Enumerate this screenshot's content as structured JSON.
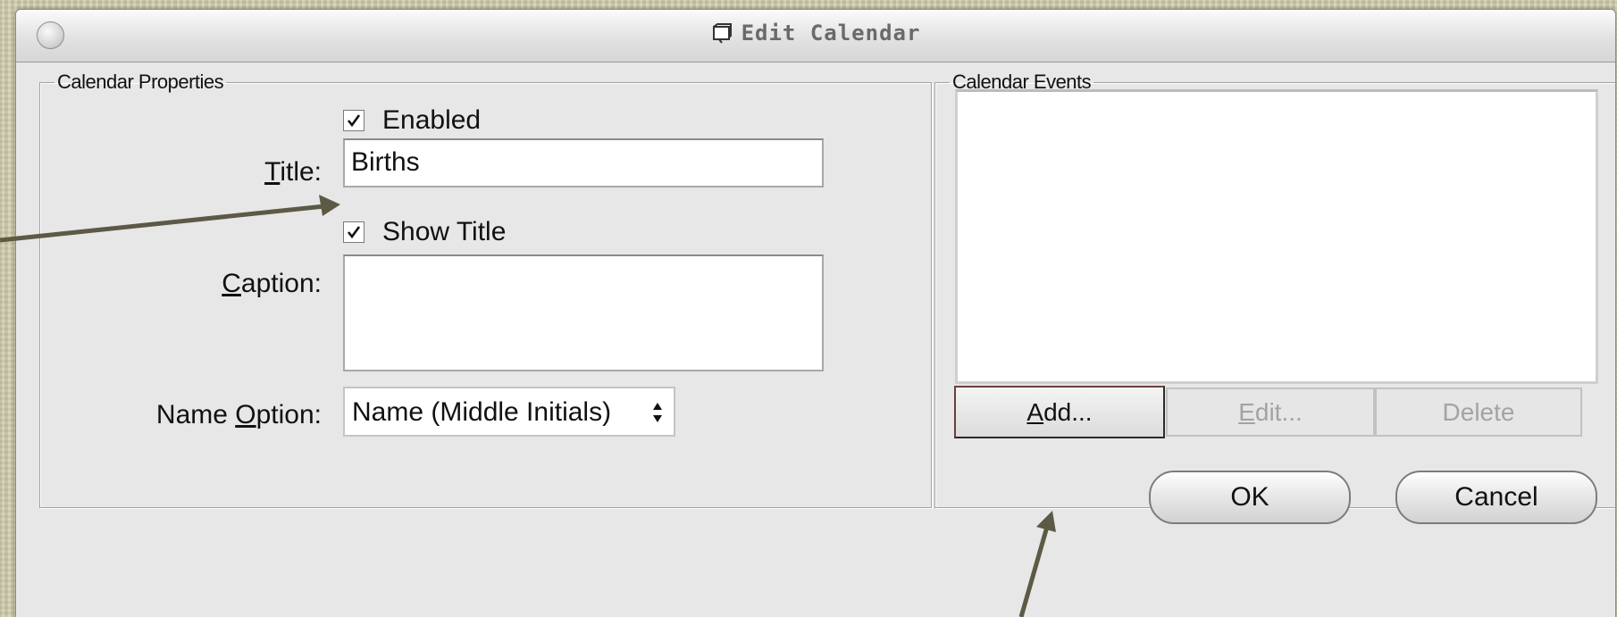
{
  "window": {
    "title": "Edit Calendar",
    "title_icon": "calendar-window-icon"
  },
  "properties": {
    "legend": "Calendar Properties",
    "enabled": {
      "label": "Enabled",
      "checked": true
    },
    "title_field": {
      "label_mnemonic": "T",
      "label_rest": "itle:",
      "value": "Births"
    },
    "show_title": {
      "label": "Show Title",
      "checked": true
    },
    "caption_field": {
      "label_mnemonic": "C",
      "label_rest": "aption:",
      "value": ""
    },
    "name_option": {
      "label_prefix": "Name ",
      "label_mnemonic": "O",
      "label_rest": "ption:",
      "selected": "Name (Middle Initials)"
    }
  },
  "events": {
    "legend": "Calendar Events",
    "items": [],
    "add": {
      "mnemonic": "A",
      "rest": "dd..."
    },
    "edit": {
      "mnemonic": "E",
      "rest": "dit..."
    },
    "delete": {
      "label": "Delete"
    }
  },
  "dialog_buttons": {
    "ok": "OK",
    "cancel": "Cancel"
  },
  "icons": [
    "close-icon",
    "calendar-window-icon",
    "checkmark-icon",
    "select-arrows-icon",
    "pointer-arrow-icon"
  ],
  "colors": {
    "desktop": "#cfcdb2",
    "window_bg": "#e7e7e7",
    "arrow": "#5c5a45",
    "disabled_text": "#a3a3a3"
  }
}
